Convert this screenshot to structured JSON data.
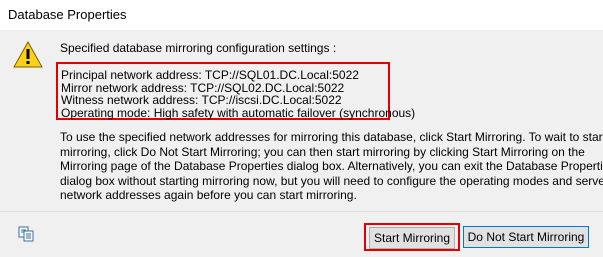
{
  "window": {
    "title": "Database Properties"
  },
  "message": {
    "icon": "warning-icon",
    "intro": "Specified database mirroring configuration settings :",
    "settings": [
      "Principal network address: TCP://SQL01.DC.Local:5022",
      "Mirror network address: TCP://SQL02.DC.Local:5022",
      "Witness network address: TCP://iscsi.DC.Local:5022",
      "Operating mode: High safety with automatic failover (synchronous)"
    ],
    "description_lines": [
      "To use the specified network addresses for mirroring this database, click Start Mirroring.  To wait to start",
      "mirroring, click Do Not Start Mirroring; you can then start mirroring by clicking Start Mirroring on the",
      "Mirroring page of the Database Properties dialog box. Alternatively, you can exit the Database Properties",
      "dialog box without starting mirroring now, but you will need to configure the operating modes and server",
      "network addresses again before you can start mirroring."
    ]
  },
  "footer": {
    "copy_icon": "copy-icon",
    "start_mirroring_label": "Start Mirroring",
    "do_not_start_label": "Do Not Start Mirroring"
  },
  "colors": {
    "highlight": "#e00000",
    "panel": "#f0f0f0",
    "focus": "#0078d7"
  }
}
